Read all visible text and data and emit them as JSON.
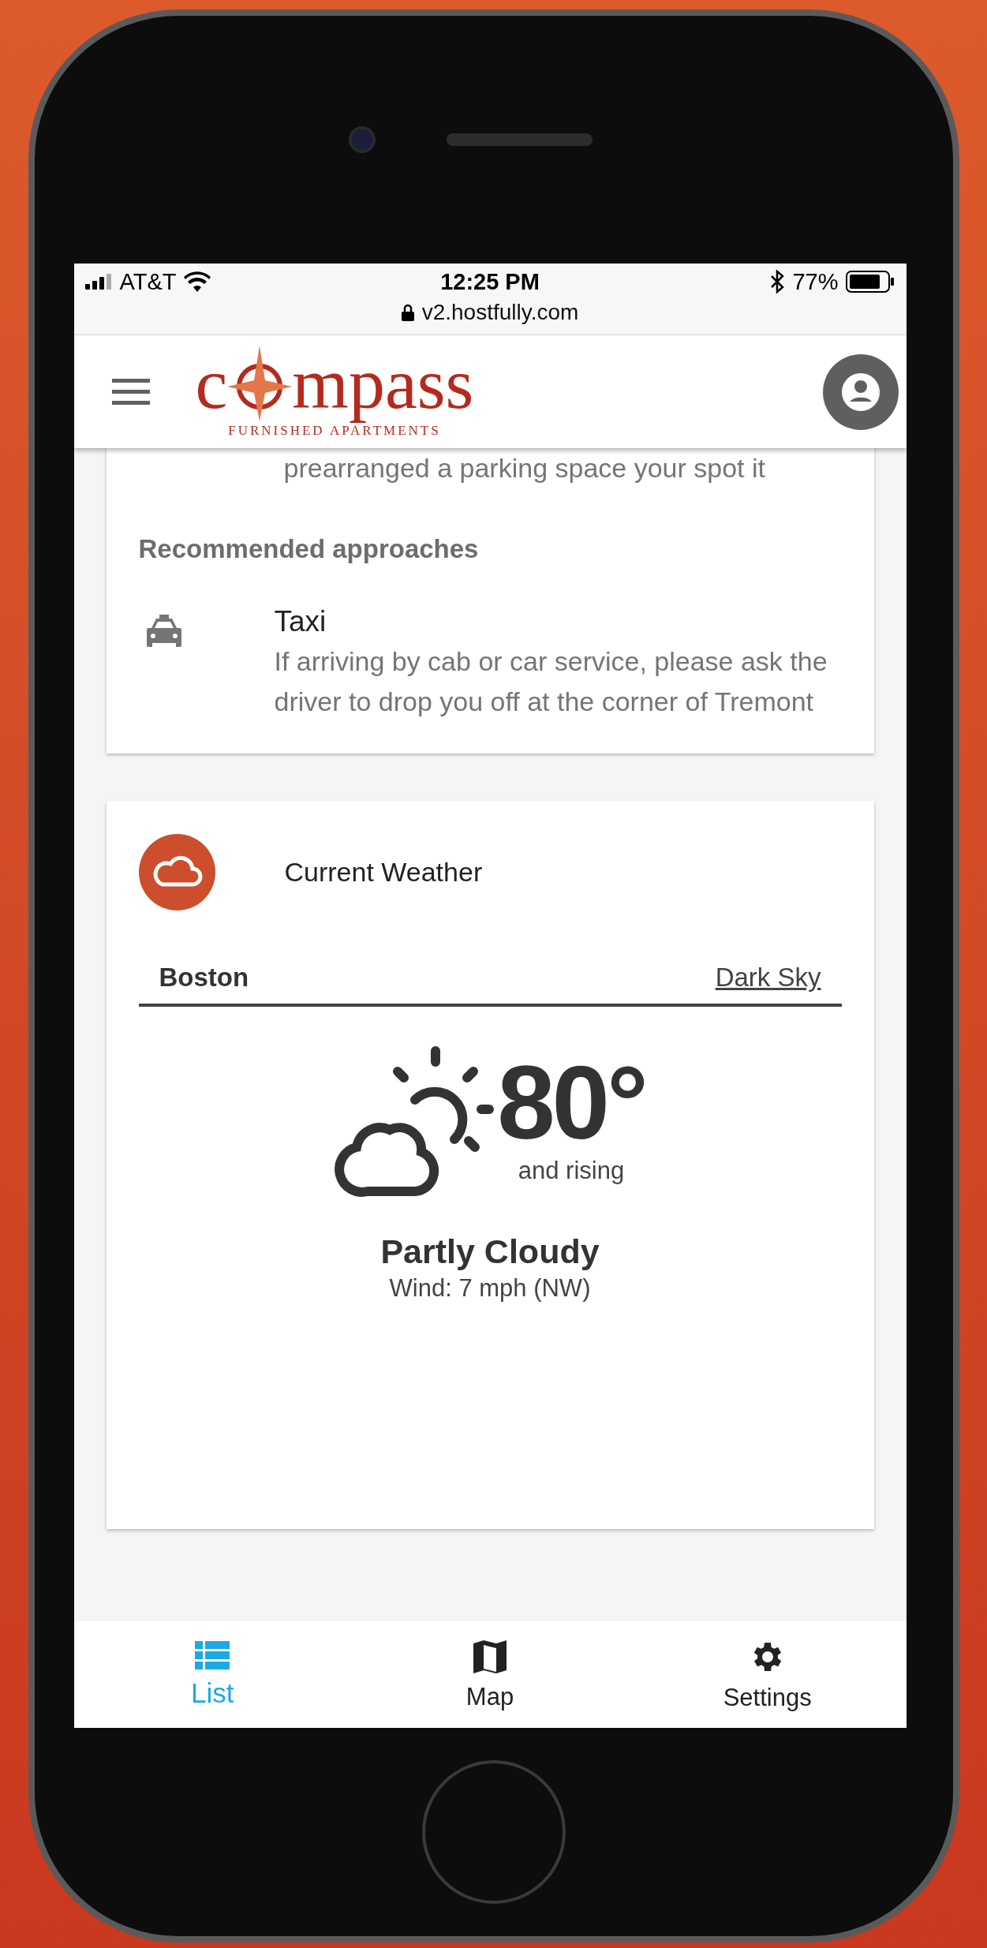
{
  "status_bar": {
    "carrier": "AT&T",
    "time": "12:25 PM",
    "battery": "77%",
    "url": "v2.hostfully.com"
  },
  "header": {
    "logo": {
      "text_start": "c",
      "text_end": "mpass",
      "tagline": "FURNISHED APARTMENTS"
    }
  },
  "directions_card": {
    "text_tail": "prearranged a parking space your spot it",
    "section_title": "Recommended approaches",
    "approaches": [
      {
        "kind": "taxi",
        "title": "Taxi",
        "description": "If arriving by cab or car service, please ask the driver to drop you off at the corner of Tremont"
      }
    ]
  },
  "weather_card": {
    "title": "Current Weather",
    "city": "Boston",
    "source_link": "Dark Sky",
    "temperature": "80°",
    "trend": "and rising",
    "condition": "Partly Cloudy",
    "wind": "Wind: 7 mph (NW)"
  },
  "bottom_nav": [
    {
      "kind": "list",
      "label": "List",
      "selected": true
    },
    {
      "kind": "map",
      "label": "Map",
      "selected": false
    },
    {
      "kind": "settings",
      "label": "Settings",
      "selected": false
    }
  ]
}
